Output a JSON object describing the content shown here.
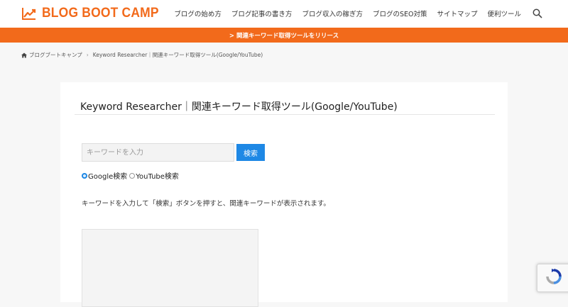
{
  "header": {
    "logo_text": "BLOG BOOT CAMP",
    "nav": [
      {
        "label": "ブログの始め方"
      },
      {
        "label": "ブログ記事の書き方"
      },
      {
        "label": "ブログ収入の稼ぎ方"
      },
      {
        "label": "ブログのSEO対策"
      },
      {
        "label": "サイトマップ"
      },
      {
        "label": "便利ツール"
      }
    ],
    "search_icon": "search-icon"
  },
  "notice_bar": {
    "text": "> 関連キーワード取得ツールをリリース"
  },
  "breadcrumb": {
    "home_icon": "home-icon",
    "home": "ブログブートキャンプ",
    "separator": "›",
    "current": "Keyword Researcher｜関連キーワード取得ツール(Google/YouTube)"
  },
  "tool": {
    "title": "Keyword Researcher｜関連キーワード取得ツール(Google/YouTube)",
    "input_value": "",
    "input_placeholder": "キーワードを入力",
    "search_button": "検索",
    "radio_options": [
      {
        "label": "Google検索",
        "selected": true
      },
      {
        "label": "YouTube検索",
        "selected": false
      }
    ],
    "instruction": "キーワードを入力して「検索」ボタンを押すと、関連キーワードが表示されます。"
  },
  "colors": {
    "brand": "#f26a1b",
    "button": "#1e88e5",
    "background": "#f7f7f7"
  }
}
